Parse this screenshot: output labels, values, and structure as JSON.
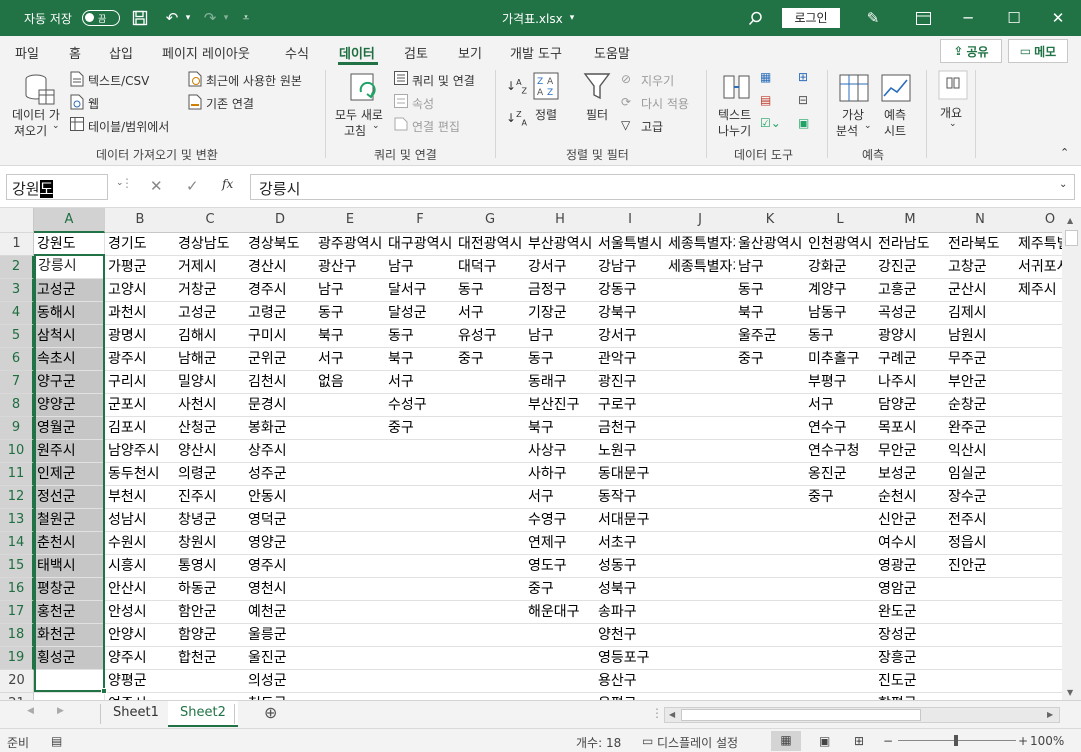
{
  "titlebar": {
    "autosave_label": "자동 저장",
    "toggle_state": "끔",
    "file_title": "가격표.xlsx",
    "login_label": "로그인"
  },
  "menu": {
    "tabs": [
      "파일",
      "홈",
      "삽입",
      "페이지 레이아웃",
      "수식",
      "데이터",
      "검토",
      "보기",
      "개발 도구",
      "도움말"
    ],
    "active_tab": "데이터",
    "share_label": "공유",
    "memo_label": "메모"
  },
  "ribbon": {
    "get_data": {
      "label1": "데이터 가",
      "label2": "져오기"
    },
    "text_csv": "텍스트/CSV",
    "web": "웹",
    "table_range": "테이블/범위에서",
    "recent_sources": "최근에 사용한 원본",
    "existing_conn": "기존 연결",
    "group1": "데이터 가져오기 및 변환",
    "refresh_all": {
      "label1": "모두 새로",
      "label2": "고침"
    },
    "queries_conn": "쿼리 및 연결",
    "properties": "속성",
    "edit_links": "연결 편집",
    "group2": "쿼리 및 연결",
    "sort": "정렬",
    "filter": "필터",
    "clear": "지우기",
    "reapply": "다시 적용",
    "advanced": "고급",
    "group3": "정렬 및 필터",
    "text_to_col": {
      "label1": "텍스트",
      "label2": "나누기"
    },
    "group4": "데이터 도구",
    "whatif": {
      "label1": "가상",
      "label2": "분석"
    },
    "forecast": {
      "label1": "예측",
      "label2": "시트"
    },
    "group5": "예측",
    "outline": "개요"
  },
  "formula_bar": {
    "name_box_prefix": "강원",
    "name_box_highlight": "도",
    "fx": "fx",
    "formula": "강릉시"
  },
  "grid": {
    "columns": [
      "A",
      "B",
      "C",
      "D",
      "E",
      "F",
      "G",
      "H",
      "I",
      "J",
      "K",
      "L",
      "M",
      "N",
      "O"
    ],
    "rows": [
      "1",
      "2",
      "3",
      "4",
      "5",
      "6",
      "7",
      "8",
      "9",
      "10",
      "11",
      "12",
      "13",
      "14",
      "15",
      "16",
      "17",
      "18",
      "19",
      "20",
      "21"
    ],
    "data": [
      [
        "강원도",
        "경기도",
        "경상남도",
        "경상북도",
        "광주광역시",
        "대구광역시",
        "대전광역시",
        "부산광역시",
        "서울특별시",
        "세종특별자치시",
        "울산광역시",
        "인천광역시",
        "전라남도",
        "전라북도",
        "제주특별자치도"
      ],
      [
        "강릉시",
        "가평군",
        "거제시",
        "경산시",
        "광산구",
        "남구",
        "대덕구",
        "강서구",
        "강남구",
        "세종특별자치시",
        "남구",
        "강화군",
        "강진군",
        "고창군",
        "서귀포시"
      ],
      [
        "고성군",
        "고양시",
        "거창군",
        "경주시",
        "남구",
        "달서구",
        "동구",
        "금정구",
        "강동구",
        "",
        "동구",
        "계양구",
        "고흥군",
        "군산시",
        "제주시"
      ],
      [
        "동해시",
        "과천시",
        "고성군",
        "고령군",
        "동구",
        "달성군",
        "서구",
        "기장군",
        "강북구",
        "",
        "북구",
        "남동구",
        "곡성군",
        "김제시",
        ""
      ],
      [
        "삼척시",
        "광명시",
        "김해시",
        "구미시",
        "북구",
        "동구",
        "유성구",
        "남구",
        "강서구",
        "",
        "울주군",
        "동구",
        "광양시",
        "남원시",
        ""
      ],
      [
        "속초시",
        "광주시",
        "남해군",
        "군위군",
        "서구",
        "북구",
        "중구",
        "동구",
        "관악구",
        "",
        "중구",
        "미추홀구",
        "구례군",
        "무주군",
        ""
      ],
      [
        "양구군",
        "구리시",
        "밀양시",
        "김천시",
        "없음",
        "서구",
        "",
        "동래구",
        "광진구",
        "",
        "",
        "부평구",
        "나주시",
        "부안군",
        ""
      ],
      [
        "양양군",
        "군포시",
        "사천시",
        "문경시",
        "",
        "수성구",
        "",
        "부산진구",
        "구로구",
        "",
        "",
        "서구",
        "담양군",
        "순창군",
        ""
      ],
      [
        "영월군",
        "김포시",
        "산청군",
        "봉화군",
        "",
        "중구",
        "",
        "북구",
        "금천구",
        "",
        "",
        "연수구",
        "목포시",
        "완주군",
        ""
      ],
      [
        "원주시",
        "남양주시",
        "양산시",
        "상주시",
        "",
        "",
        "",
        "사상구",
        "노원구",
        "",
        "",
        "연수구청",
        "무안군",
        "익산시",
        ""
      ],
      [
        "인제군",
        "동두천시",
        "의령군",
        "성주군",
        "",
        "",
        "",
        "사하구",
        "동대문구",
        "",
        "",
        "옹진군",
        "보성군",
        "임실군",
        ""
      ],
      [
        "정선군",
        "부천시",
        "진주시",
        "안동시",
        "",
        "",
        "",
        "서구",
        "동작구",
        "",
        "",
        "중구",
        "순천시",
        "장수군",
        ""
      ],
      [
        "철원군",
        "성남시",
        "창녕군",
        "영덕군",
        "",
        "",
        "",
        "수영구",
        "서대문구",
        "",
        "",
        "",
        "신안군",
        "전주시",
        ""
      ],
      [
        "춘천시",
        "수원시",
        "창원시",
        "영양군",
        "",
        "",
        "",
        "연제구",
        "서초구",
        "",
        "",
        "",
        "여수시",
        "정읍시",
        ""
      ],
      [
        "태백시",
        "시흥시",
        "통영시",
        "영주시",
        "",
        "",
        "",
        "영도구",
        "성동구",
        "",
        "",
        "",
        "영광군",
        "진안군",
        ""
      ],
      [
        "평창군",
        "안산시",
        "하동군",
        "영천시",
        "",
        "",
        "",
        "중구",
        "성북구",
        "",
        "",
        "",
        "영암군",
        "",
        ""
      ],
      [
        "홍천군",
        "안성시",
        "함안군",
        "예천군",
        "",
        "",
        "",
        "해운대구",
        "송파구",
        "",
        "",
        "",
        "완도군",
        "",
        ""
      ],
      [
        "화천군",
        "안양시",
        "함양군",
        "울릉군",
        "",
        "",
        "",
        "",
        "양천구",
        "",
        "",
        "",
        "장성군",
        "",
        ""
      ],
      [
        "횡성군",
        "양주시",
        "합천군",
        "울진군",
        "",
        "",
        "",
        "",
        "영등포구",
        "",
        "",
        "",
        "장흥군",
        "",
        ""
      ],
      [
        "",
        "양평군",
        "",
        "의성군",
        "",
        "",
        "",
        "",
        "용산구",
        "",
        "",
        "",
        "진도군",
        "",
        ""
      ],
      [
        "",
        "여주시",
        "",
        "청도군",
        "",
        "",
        "",
        "",
        "은평구",
        "",
        "",
        "",
        "함평군",
        "",
        ""
      ]
    ]
  },
  "sheets": [
    "Sheet1",
    "Sheet2"
  ],
  "active_sheet": "Sheet2",
  "status": {
    "ready": "준비",
    "count": "개수: 18",
    "display_settings": "디스플레이 설정",
    "zoom": "100%"
  },
  "colors": {
    "accent": "#217346",
    "selection": "#c6c6c6"
  }
}
